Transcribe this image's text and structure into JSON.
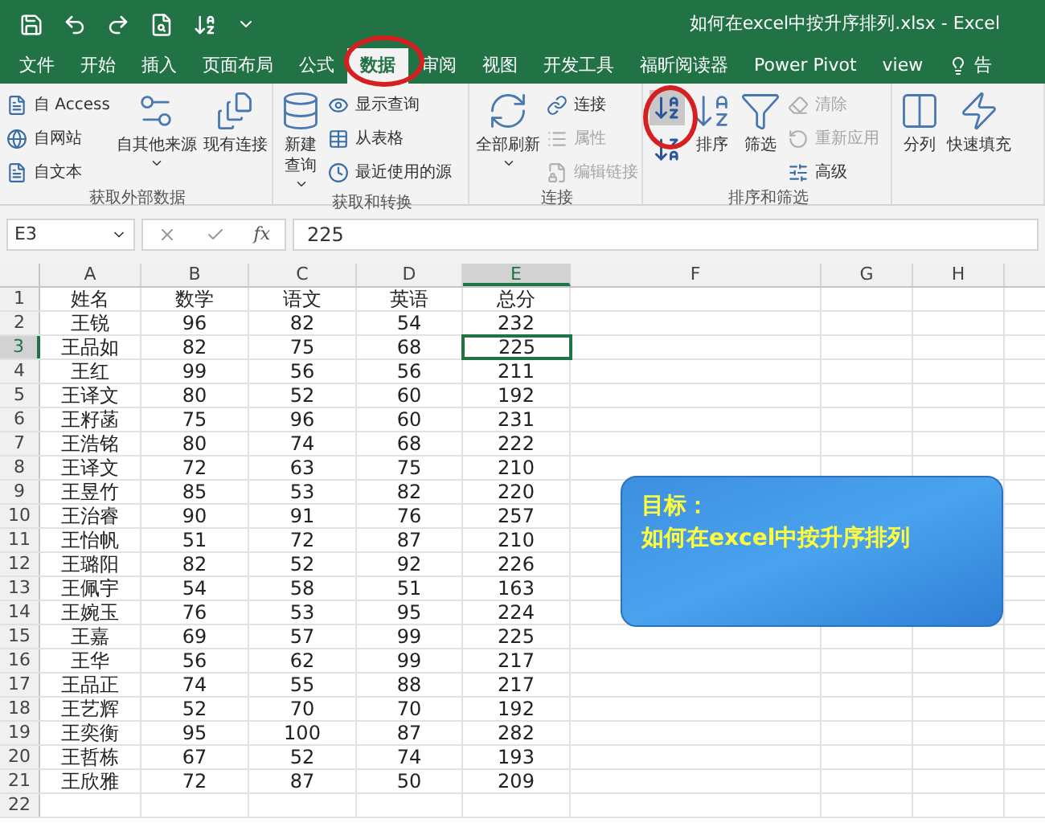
{
  "window": {
    "title": "如何在excel中按升序排列.xlsx  -  Excel"
  },
  "tabs": [
    {
      "label": "文件",
      "selected": false
    },
    {
      "label": "开始",
      "selected": false
    },
    {
      "label": "插入",
      "selected": false
    },
    {
      "label": "页面布局",
      "selected": false
    },
    {
      "label": "公式",
      "selected": false
    },
    {
      "label": "数据",
      "selected": true
    },
    {
      "label": "审阅",
      "selected": false
    },
    {
      "label": "视图",
      "selected": false
    },
    {
      "label": "开发工具",
      "selected": false
    },
    {
      "label": "福昕阅读器",
      "selected": false
    },
    {
      "label": "Power Pivot",
      "selected": false
    },
    {
      "label": "view",
      "selected": false
    },
    {
      "label": "告",
      "selected": false
    }
  ],
  "ribbon": {
    "groups": [
      {
        "label": "获取外部数据",
        "columns": [
          {
            "kind": "stack",
            "items": [
              {
                "label": "自 Access",
                "disabled": false
              },
              {
                "label": "自网站",
                "disabled": false
              },
              {
                "label": "自文本",
                "disabled": false
              }
            ]
          },
          {
            "kind": "large",
            "lines": [
              "自其他来源"
            ],
            "dropdown": true
          },
          {
            "kind": "large",
            "lines": [
              "现有连接"
            ],
            "dropdown": false
          }
        ]
      },
      {
        "label": "获取和转换",
        "columns": [
          {
            "kind": "large",
            "lines": [
              "新建",
              "查询"
            ],
            "dropdown": true
          },
          {
            "kind": "stack",
            "items": [
              {
                "label": "显示查询",
                "disabled": false
              },
              {
                "label": "从表格",
                "disabled": false
              },
              {
                "label": "最近使用的源",
                "disabled": false
              }
            ]
          }
        ]
      },
      {
        "label": "连接",
        "columns": [
          {
            "kind": "large",
            "lines": [
              "全部刷新"
            ],
            "dropdown": true
          },
          {
            "kind": "stack",
            "items": [
              {
                "label": "连接",
                "disabled": false
              },
              {
                "label": "属性",
                "disabled": true
              },
              {
                "label": "编辑链接",
                "disabled": true
              }
            ]
          }
        ]
      },
      {
        "label": "排序和筛选",
        "columns": [
          {
            "kind": "sort"
          },
          {
            "kind": "large",
            "lines": [
              "排序"
            ],
            "dropdown": false
          },
          {
            "kind": "large",
            "lines": [
              "筛选"
            ],
            "dropdown": false
          },
          {
            "kind": "stack",
            "items": [
              {
                "label": "清除",
                "disabled": true
              },
              {
                "label": "重新应用",
                "disabled": true
              },
              {
                "label": "高级",
                "disabled": false
              }
            ]
          }
        ]
      },
      {
        "columns": [
          {
            "kind": "large",
            "lines": [
              "分列"
            ],
            "dropdown": false
          },
          {
            "kind": "large",
            "lines": [
              "快速填充"
            ],
            "dropdown": false
          }
        ]
      }
    ]
  },
  "formula_bar": {
    "name_box": "E3",
    "function_label": "fx",
    "value": "225"
  },
  "sheet": {
    "columns": [
      {
        "label": "A",
        "selected": false
      },
      {
        "label": "B",
        "selected": false
      },
      {
        "label": "C",
        "selected": false
      },
      {
        "label": "D",
        "selected": false
      },
      {
        "label": "E",
        "selected": true
      },
      {
        "label": "F",
        "selected": false
      },
      {
        "label": "G",
        "selected": false
      },
      {
        "label": "H",
        "selected": false
      }
    ],
    "rows": [
      {
        "number": "1",
        "selected": false,
        "cells": [
          "姓名",
          "数学",
          "语文",
          "英语",
          "总分"
        ]
      },
      {
        "number": "2",
        "selected": false,
        "cells": [
          "王锐",
          "96",
          "82",
          "54",
          "232"
        ]
      },
      {
        "number": "3",
        "selected": true,
        "cells": [
          "王品如",
          "82",
          "75",
          "68",
          "225"
        ]
      },
      {
        "number": "4",
        "selected": false,
        "cells": [
          "王红",
          "99",
          "56",
          "56",
          "211"
        ]
      },
      {
        "number": "5",
        "selected": false,
        "cells": [
          "王译文",
          "80",
          "52",
          "60",
          "192"
        ]
      },
      {
        "number": "6",
        "selected": false,
        "cells": [
          "王籽菡",
          "75",
          "96",
          "60",
          "231"
        ]
      },
      {
        "number": "7",
        "selected": false,
        "cells": [
          "王浩铭",
          "80",
          "74",
          "68",
          "222"
        ]
      },
      {
        "number": "8",
        "selected": false,
        "cells": [
          "王译文",
          "72",
          "63",
          "75",
          "210"
        ]
      },
      {
        "number": "9",
        "selected": false,
        "cells": [
          "王昱竹",
          "85",
          "53",
          "82",
          "220"
        ]
      },
      {
        "number": "10",
        "selected": false,
        "cells": [
          "王治睿",
          "90",
          "91",
          "76",
          "257"
        ]
      },
      {
        "number": "11",
        "selected": false,
        "cells": [
          "王怡帆",
          "51",
          "72",
          "87",
          "210"
        ]
      },
      {
        "number": "12",
        "selected": false,
        "cells": [
          "王璐阳",
          "82",
          "52",
          "92",
          "226"
        ]
      },
      {
        "number": "13",
        "selected": false,
        "cells": [
          "王佩宇",
          "54",
          "58",
          "51",
          "163"
        ]
      },
      {
        "number": "14",
        "selected": false,
        "cells": [
          "王婉玉",
          "76",
          "53",
          "95",
          "224"
        ]
      },
      {
        "number": "15",
        "selected": false,
        "cells": [
          "王嘉",
          "69",
          "57",
          "99",
          "225"
        ]
      },
      {
        "number": "16",
        "selected": false,
        "cells": [
          "王华",
          "56",
          "62",
          "99",
          "217"
        ]
      },
      {
        "number": "17",
        "selected": false,
        "cells": [
          "王品正",
          "74",
          "55",
          "88",
          "217"
        ]
      },
      {
        "number": "18",
        "selected": false,
        "cells": [
          "王艺辉",
          "52",
          "70",
          "70",
          "192"
        ]
      },
      {
        "number": "19",
        "selected": false,
        "cells": [
          "王奕衡",
          "95",
          "100",
          "87",
          "282"
        ]
      },
      {
        "number": "20",
        "selected": false,
        "cells": [
          "王哲栋",
          "67",
          "52",
          "74",
          "193"
        ]
      },
      {
        "number": "21",
        "selected": false,
        "cells": [
          "王欣雅",
          "72",
          "87",
          "50",
          "209"
        ]
      },
      {
        "number": "22",
        "selected": false,
        "cells": []
      }
    ]
  },
  "callout": {
    "title": "目标：",
    "text": "如何在excel中按升序排列"
  }
}
